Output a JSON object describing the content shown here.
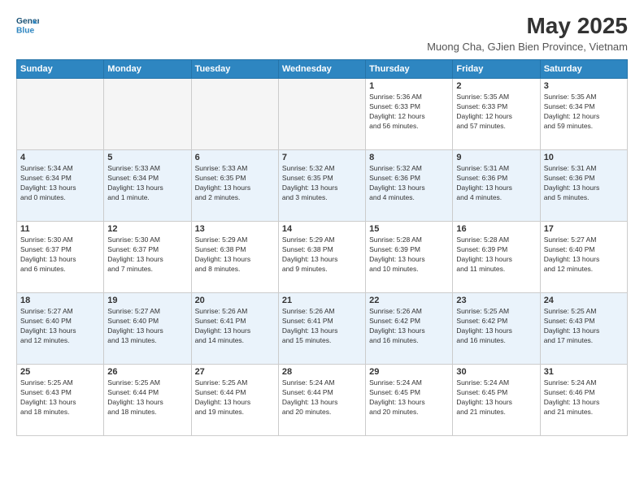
{
  "header": {
    "logo_line1": "General",
    "logo_line2": "Blue",
    "month_title": "May 2025",
    "location": "Muong Cha, GJien Bien Province, Vietnam"
  },
  "weekdays": [
    "Sunday",
    "Monday",
    "Tuesday",
    "Wednesday",
    "Thursday",
    "Friday",
    "Saturday"
  ],
  "weeks": [
    [
      {
        "day": "",
        "info": ""
      },
      {
        "day": "",
        "info": ""
      },
      {
        "day": "",
        "info": ""
      },
      {
        "day": "",
        "info": ""
      },
      {
        "day": "1",
        "info": "Sunrise: 5:36 AM\nSunset: 6:33 PM\nDaylight: 12 hours\nand 56 minutes."
      },
      {
        "day": "2",
        "info": "Sunrise: 5:35 AM\nSunset: 6:33 PM\nDaylight: 12 hours\nand 57 minutes."
      },
      {
        "day": "3",
        "info": "Sunrise: 5:35 AM\nSunset: 6:34 PM\nDaylight: 12 hours\nand 59 minutes."
      }
    ],
    [
      {
        "day": "4",
        "info": "Sunrise: 5:34 AM\nSunset: 6:34 PM\nDaylight: 13 hours\nand 0 minutes."
      },
      {
        "day": "5",
        "info": "Sunrise: 5:33 AM\nSunset: 6:34 PM\nDaylight: 13 hours\nand 1 minute."
      },
      {
        "day": "6",
        "info": "Sunrise: 5:33 AM\nSunset: 6:35 PM\nDaylight: 13 hours\nand 2 minutes."
      },
      {
        "day": "7",
        "info": "Sunrise: 5:32 AM\nSunset: 6:35 PM\nDaylight: 13 hours\nand 3 minutes."
      },
      {
        "day": "8",
        "info": "Sunrise: 5:32 AM\nSunset: 6:36 PM\nDaylight: 13 hours\nand 4 minutes."
      },
      {
        "day": "9",
        "info": "Sunrise: 5:31 AM\nSunset: 6:36 PM\nDaylight: 13 hours\nand 4 minutes."
      },
      {
        "day": "10",
        "info": "Sunrise: 5:31 AM\nSunset: 6:36 PM\nDaylight: 13 hours\nand 5 minutes."
      }
    ],
    [
      {
        "day": "11",
        "info": "Sunrise: 5:30 AM\nSunset: 6:37 PM\nDaylight: 13 hours\nand 6 minutes."
      },
      {
        "day": "12",
        "info": "Sunrise: 5:30 AM\nSunset: 6:37 PM\nDaylight: 13 hours\nand 7 minutes."
      },
      {
        "day": "13",
        "info": "Sunrise: 5:29 AM\nSunset: 6:38 PM\nDaylight: 13 hours\nand 8 minutes."
      },
      {
        "day": "14",
        "info": "Sunrise: 5:29 AM\nSunset: 6:38 PM\nDaylight: 13 hours\nand 9 minutes."
      },
      {
        "day": "15",
        "info": "Sunrise: 5:28 AM\nSunset: 6:39 PM\nDaylight: 13 hours\nand 10 minutes."
      },
      {
        "day": "16",
        "info": "Sunrise: 5:28 AM\nSunset: 6:39 PM\nDaylight: 13 hours\nand 11 minutes."
      },
      {
        "day": "17",
        "info": "Sunrise: 5:27 AM\nSunset: 6:40 PM\nDaylight: 13 hours\nand 12 minutes."
      }
    ],
    [
      {
        "day": "18",
        "info": "Sunrise: 5:27 AM\nSunset: 6:40 PM\nDaylight: 13 hours\nand 12 minutes."
      },
      {
        "day": "19",
        "info": "Sunrise: 5:27 AM\nSunset: 6:40 PM\nDaylight: 13 hours\nand 13 minutes."
      },
      {
        "day": "20",
        "info": "Sunrise: 5:26 AM\nSunset: 6:41 PM\nDaylight: 13 hours\nand 14 minutes."
      },
      {
        "day": "21",
        "info": "Sunrise: 5:26 AM\nSunset: 6:41 PM\nDaylight: 13 hours\nand 15 minutes."
      },
      {
        "day": "22",
        "info": "Sunrise: 5:26 AM\nSunset: 6:42 PM\nDaylight: 13 hours\nand 16 minutes."
      },
      {
        "day": "23",
        "info": "Sunrise: 5:25 AM\nSunset: 6:42 PM\nDaylight: 13 hours\nand 16 minutes."
      },
      {
        "day": "24",
        "info": "Sunrise: 5:25 AM\nSunset: 6:43 PM\nDaylight: 13 hours\nand 17 minutes."
      }
    ],
    [
      {
        "day": "25",
        "info": "Sunrise: 5:25 AM\nSunset: 6:43 PM\nDaylight: 13 hours\nand 18 minutes."
      },
      {
        "day": "26",
        "info": "Sunrise: 5:25 AM\nSunset: 6:44 PM\nDaylight: 13 hours\nand 18 minutes."
      },
      {
        "day": "27",
        "info": "Sunrise: 5:25 AM\nSunset: 6:44 PM\nDaylight: 13 hours\nand 19 minutes."
      },
      {
        "day": "28",
        "info": "Sunrise: 5:24 AM\nSunset: 6:44 PM\nDaylight: 13 hours\nand 20 minutes."
      },
      {
        "day": "29",
        "info": "Sunrise: 5:24 AM\nSunset: 6:45 PM\nDaylight: 13 hours\nand 20 minutes."
      },
      {
        "day": "30",
        "info": "Sunrise: 5:24 AM\nSunset: 6:45 PM\nDaylight: 13 hours\nand 21 minutes."
      },
      {
        "day": "31",
        "info": "Sunrise: 5:24 AM\nSunset: 6:46 PM\nDaylight: 13 hours\nand 21 minutes."
      }
    ]
  ]
}
